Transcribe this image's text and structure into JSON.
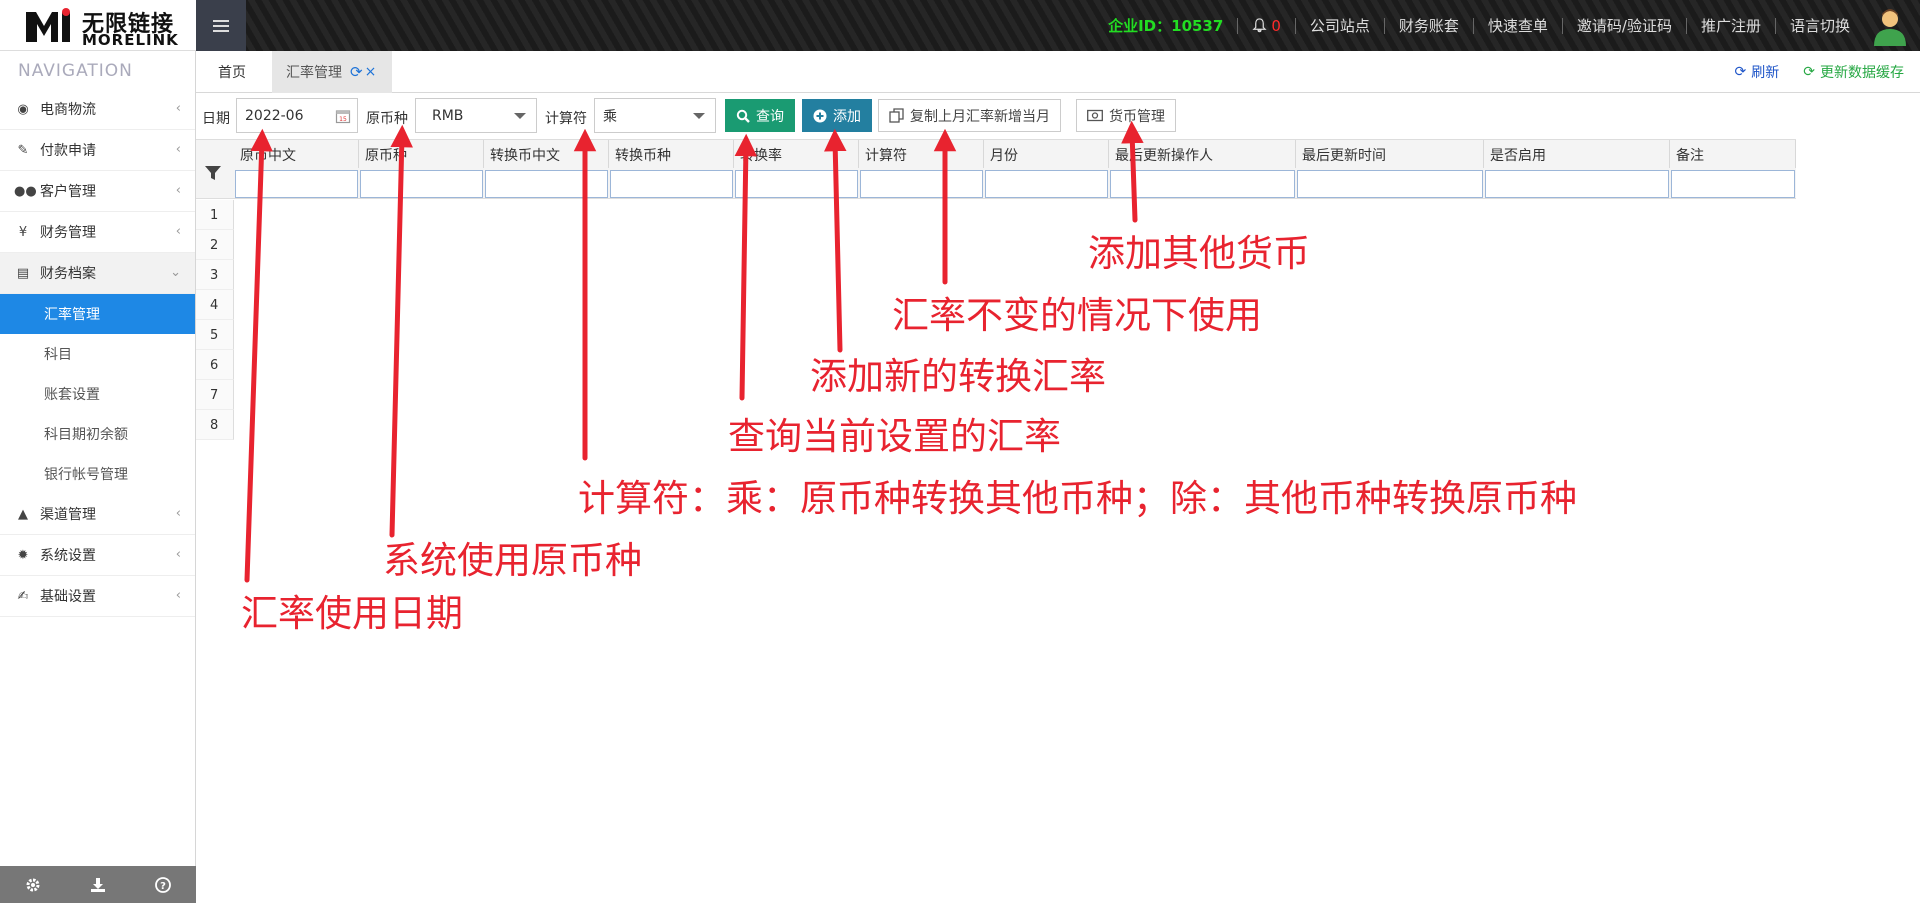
{
  "header": {
    "logo_cn": "无限链接",
    "logo_en": "MORELINK",
    "company_id_label": "企业ID：10537",
    "notification_count": "0",
    "links": [
      "公司站点",
      "财务账套",
      "快速查单",
      "邀请码/验证码",
      "推广注册",
      "语言切换"
    ]
  },
  "sidebar": {
    "title": "NAVIGATION",
    "items": [
      {
        "label": "电商物流",
        "icon": "globe-icon"
      },
      {
        "label": "付款申请",
        "icon": "payment-icon"
      },
      {
        "label": "客户管理",
        "icon": "users-icon"
      },
      {
        "label": "财务管理",
        "icon": "yen-icon"
      },
      {
        "label": "财务档案",
        "icon": "book-icon"
      }
    ],
    "sub_items": [
      "汇率管理",
      "科目",
      "账套设置",
      "科目期初余额",
      "银行帐号管理"
    ],
    "items_after": [
      {
        "label": "渠道管理",
        "icon": "road-icon"
      },
      {
        "label": "系统设置",
        "icon": "gear-icon"
      },
      {
        "label": "基础设置",
        "icon": "edit-icon"
      }
    ],
    "footer_icons": [
      "gear-icon",
      "download-icon",
      "help-icon"
    ]
  },
  "tabs": {
    "home": "首页",
    "current": "汇率管理",
    "refresh": "刷新",
    "update_cache": "更新数据缓存"
  },
  "toolbar": {
    "date_label": "日期",
    "date_value": "2022-06",
    "currency_label": "原币种",
    "currency_value": "RMB",
    "operator_label": "计算符",
    "operator_value": "乘",
    "query_btn": "查询",
    "add_btn": "添加",
    "copy_btn": "复制上月汇率新增当月",
    "currency_mgmt_btn": "货币管理"
  },
  "grid": {
    "columns": [
      "原币中文",
      "原币种",
      "转换币中文",
      "转换币种",
      "转换率",
      "计算符",
      "月份",
      "最后更新操作人",
      "最后更新时间",
      "是否启用",
      "备注"
    ],
    "row_numbers": [
      "1",
      "2",
      "3",
      "4",
      "5",
      "6",
      "7",
      "8"
    ]
  },
  "annotations": {
    "currency_mgmt": "添加其他货币",
    "copy_last_month": "汇率不变的情况下使用",
    "add": "添加新的转换汇率",
    "query": "查询当前设置的汇率",
    "operator": "计算符：乘：原币种转换其他币种；除：其他币种转换原币种",
    "currency": "系统使用原币种",
    "date": "汇率使用日期"
  },
  "colors": {
    "accent": "#1e88e5",
    "annotation": "#e8232f",
    "query_button": "#1a9b72",
    "add_button": "#237fa0",
    "company_id": "#22dd22"
  }
}
